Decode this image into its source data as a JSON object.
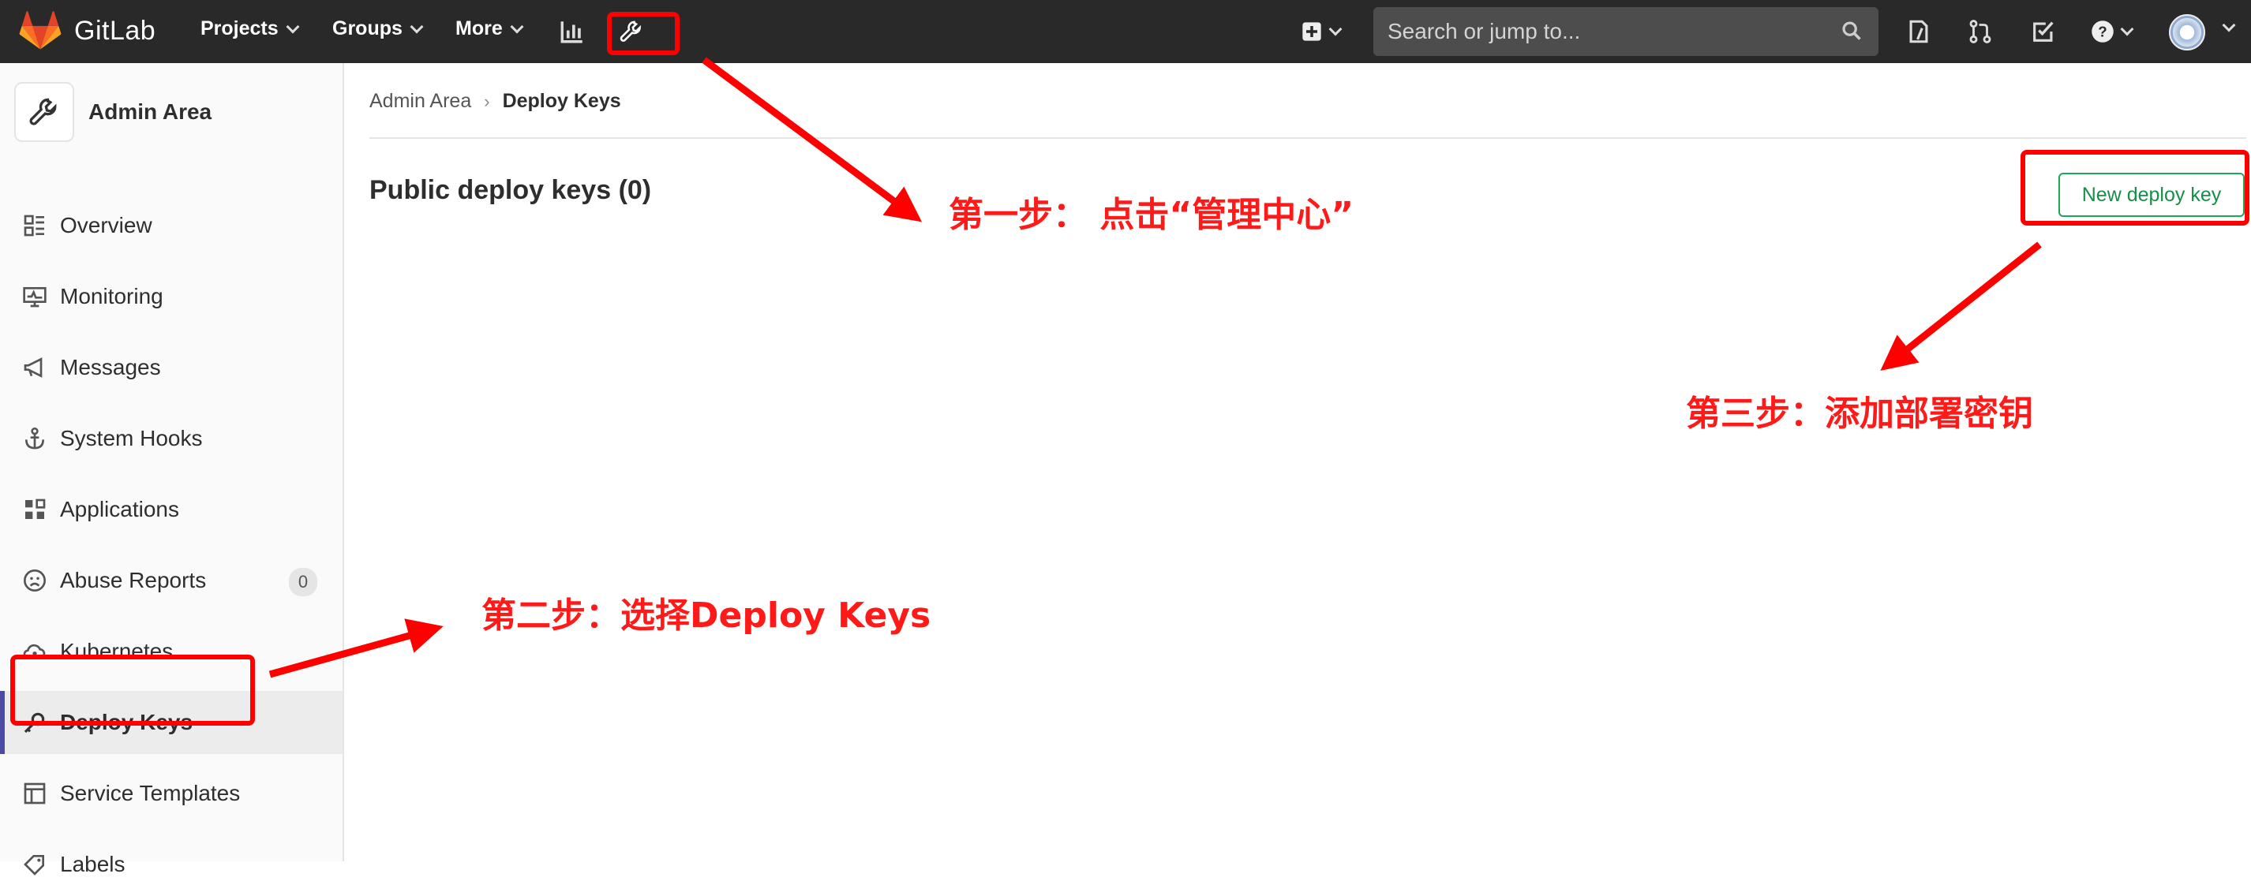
{
  "brand": {
    "name": "GitLab"
  },
  "topnav": {
    "projects_label": "Projects",
    "groups_label": "Groups",
    "more_label": "More",
    "search_placeholder": "Search or jump to..."
  },
  "sidebar": {
    "title": "Admin Area",
    "items": [
      {
        "label": "Overview",
        "icon": "overview-icon"
      },
      {
        "label": "Monitoring",
        "icon": "monitor-icon"
      },
      {
        "label": "Messages",
        "icon": "megaphone-icon"
      },
      {
        "label": "System Hooks",
        "icon": "anchor-icon"
      },
      {
        "label": "Applications",
        "icon": "grid-icon"
      },
      {
        "label": "Abuse Reports",
        "icon": "sad-face-icon",
        "badge": "0"
      },
      {
        "label": "Kubernetes",
        "icon": "cloud-gear-icon"
      },
      {
        "label": "Deploy Keys",
        "icon": "key-icon",
        "active": true
      },
      {
        "label": "Service Templates",
        "icon": "template-icon"
      },
      {
        "label": "Labels",
        "icon": "label-icon"
      }
    ]
  },
  "breadcrumb": {
    "parent": "Admin Area",
    "current": "Deploy Keys"
  },
  "main": {
    "title": "Public deploy keys (0)",
    "new_button_label": "New deploy key"
  },
  "annotations": {
    "step1": "第一步：  点击“管理中心”",
    "step2": "第二步：选择Deploy Keys",
    "step3": "第三步：添加部署密钥"
  },
  "colors": {
    "topbar": "#292929",
    "accent_green": "#1aaa55",
    "annotation_red": "#ff0000"
  }
}
